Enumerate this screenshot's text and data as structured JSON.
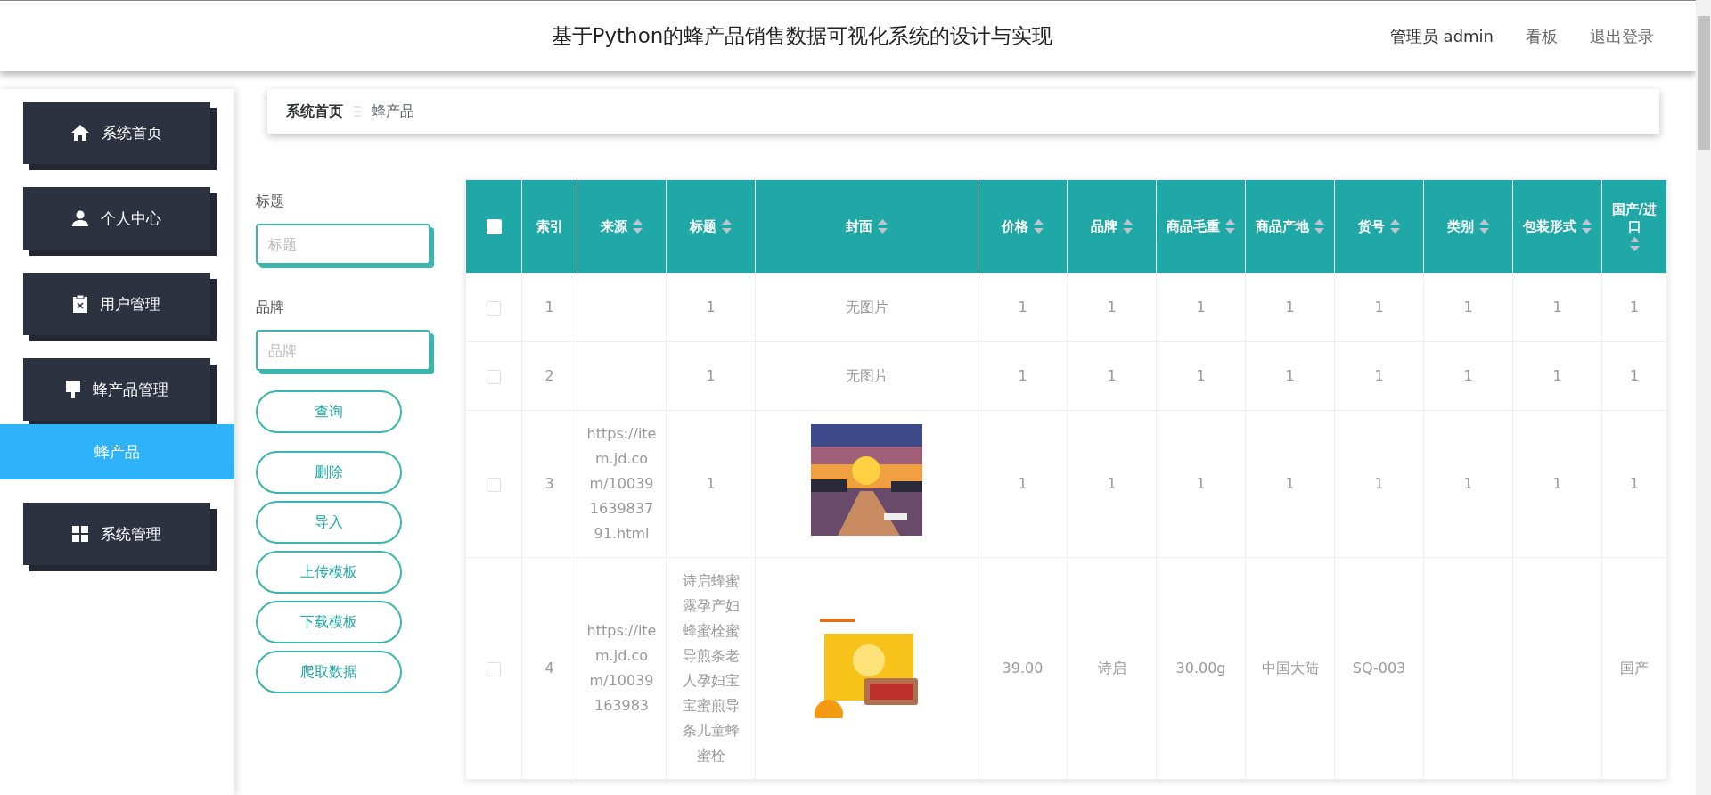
{
  "header": {
    "title": "基于Python的蜂产品销售数据可视化系统的设计与实现",
    "links": [
      {
        "label": "管理员 admin",
        "kind": "user"
      },
      {
        "label": "看板",
        "kind": "link"
      },
      {
        "label": "退出登录",
        "kind": "link"
      }
    ]
  },
  "sidebar": {
    "items": [
      {
        "label": "系统首页",
        "selected": false
      },
      {
        "label": "个人中心",
        "selected": false
      },
      {
        "label": "用户管理",
        "selected": false
      },
      {
        "label": "蜂产品管理",
        "selected": false,
        "children": [
          {
            "label": "蜂产品",
            "selected": true
          }
        ]
      },
      {
        "label": "系统管理",
        "selected": false
      }
    ]
  },
  "breadcrumb": [
    "系统首页",
    "蜂产品"
  ],
  "search": {
    "fields": [
      {
        "label": "标题",
        "placeholder": "标题"
      },
      {
        "label": "品牌",
        "placeholder": "品牌"
      }
    ],
    "buttons": [
      "查询",
      "删除",
      "导入",
      "上传模板",
      "下载模板",
      "爬取数据"
    ]
  },
  "table": {
    "select_all": {
      "checked": false
    },
    "columns": [
      {
        "label": "索引",
        "sortable": false
      },
      {
        "label": "来源",
        "sortable": true
      },
      {
        "label": "标题",
        "sortable": true
      },
      {
        "label": "封面",
        "sortable": true
      },
      {
        "label": "价格",
        "sortable": true
      },
      {
        "label": "品牌",
        "sortable": true
      },
      {
        "label": "商品毛重",
        "sortable": true
      },
      {
        "label": "商品产地",
        "sortable": true
      },
      {
        "label": "货号",
        "sortable": true
      },
      {
        "label": "类别",
        "sortable": true
      },
      {
        "label": "包装形式",
        "sortable": true
      },
      {
        "label": "国产/进口",
        "sortable": true
      }
    ],
    "rows": [
      {
        "checked": false,
        "index": "1",
        "title": "1",
        "cover": {
          "kind": "text",
          "text": "无图片"
        },
        "rest": {
          "price": "1",
          "brand": "1",
          "weight": "1",
          "origin": "1",
          "item_no": "1",
          "category": "1",
          "packaging": "1",
          "domestic_import": "1"
        }
      },
      {
        "checked": false,
        "index": "2",
        "title": "1",
        "cover": {
          "kind": "text",
          "text": "无图片"
        },
        "rest": {
          "price": "1",
          "brand": "1",
          "weight": "1",
          "origin": "1",
          "item_no": "1",
          "category": "1",
          "packaging": "1",
          "domestic_import": "1"
        }
      },
      {
        "checked": false,
        "index": "3",
        "source": "https://item.jd.com/10039163983791.html",
        "title": "1",
        "rest": {
          "price": "1",
          "brand": "1",
          "weight": "1",
          "origin": "1",
          "item_no": "1",
          "category": "1",
          "packaging": "1",
          "domestic_import": "1"
        }
      },
      {
        "checked": false,
        "index": "4",
        "source": "https://item.jd.com/10039163983",
        "title": "诗启蜂蜜露孕产妇蜂蜜栓蜜导煎条老人孕妇宝宝蜜煎导条儿童蜂蜜栓",
        "rest": {
          "price": "39.00",
          "brand": "诗启",
          "weight": "30.00g",
          "origin": "中国大陆",
          "item_no": "SQ-003",
          "domestic_import": "国产"
        }
      }
    ]
  }
}
